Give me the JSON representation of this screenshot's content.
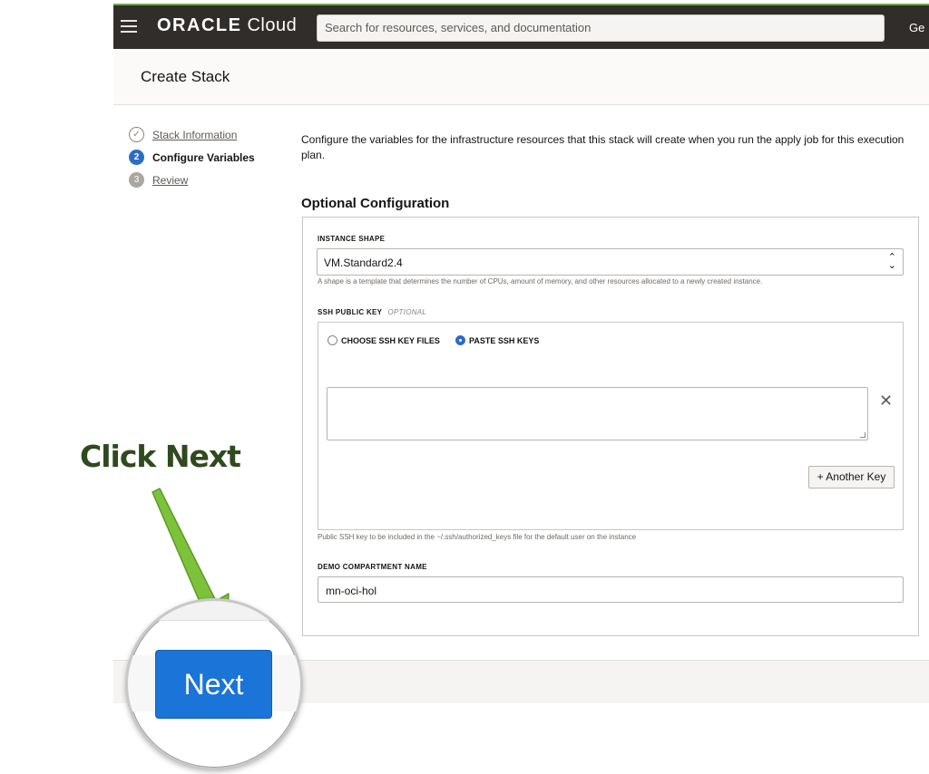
{
  "topbar": {
    "brand_main": "ORACLE",
    "brand_sub": "Cloud",
    "search_placeholder": "Search for resources, services, and documentation",
    "region_text": "Ge"
  },
  "page": {
    "title": "Create Stack"
  },
  "wizard": {
    "steps": [
      {
        "number": "✓",
        "label": "Stack Information",
        "state": "done"
      },
      {
        "number": "2",
        "label": "Configure Variables",
        "state": "active"
      },
      {
        "number": "3",
        "label": "Review",
        "state": "todo"
      }
    ]
  },
  "content": {
    "intro": "Configure the variables for the infrastructure resources that this stack will create when you run the apply job for this execution plan.",
    "section_title": "Optional Configuration",
    "instance_shape": {
      "label": "INSTANCE SHAPE",
      "value": "VM.Standard2.4",
      "help": "A shape is a template that determines the number of CPUs, amount of memory, and other resources allocated to a newly created instance."
    },
    "ssh": {
      "label": "SSH PUBLIC KEY",
      "optional": "OPTIONAL",
      "option_files": "CHOOSE SSH KEY FILES",
      "option_paste": "PASTE SSH KEYS",
      "add_key": "+ Another Key",
      "help": "Public SSH key to be included in the ~/.ssh/authorized_keys file for the default user on the instance"
    },
    "compartment": {
      "label": "DEMO COMPARTMENT NAME",
      "value": "mn-oci-hol"
    }
  },
  "annotation": {
    "callout": "Click Next",
    "button_label": "Next"
  },
  "colors": {
    "topbar": "#312d2a",
    "accent_blue": "#1b74d8",
    "arrow_green": "#7cc23a",
    "callout_text": "#2f4a1e"
  }
}
